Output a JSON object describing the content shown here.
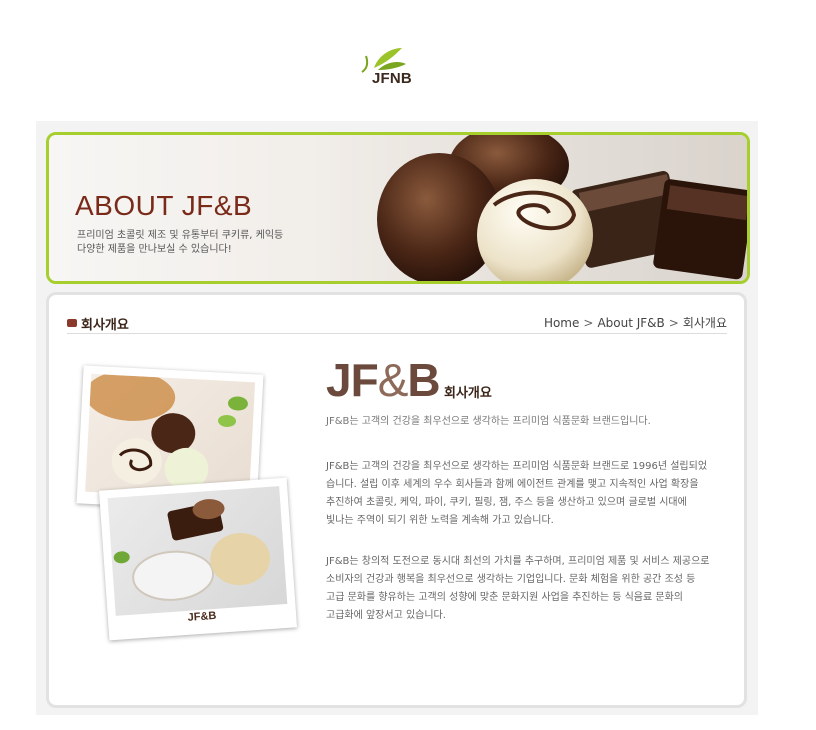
{
  "logo": {
    "text": "JFNB"
  },
  "banner": {
    "title": "ABOUT JF&B",
    "sub_line1": "프리미엄 초콜릿 제조 및 유통부터 쿠키류, 케익등",
    "sub_line2": "다양한 제품을 만나보실 수 있습니다!"
  },
  "section": {
    "heading": "회사개요",
    "breadcrumb": [
      "Home",
      "About JF&B",
      "회사개요"
    ],
    "breadcrumb_sep": ">"
  },
  "photo": {
    "caption": "JF&B"
  },
  "intro": {
    "brand_left": "JF",
    "brand_amp": "&",
    "brand_right": "B",
    "brand_sub": "회사개요",
    "tagline": "JF&B는 고객의 건강을 최우선으로 생각하는 프리미엄 식품문화 브랜드입니다.",
    "paragraph1": [
      "JF&B는 고객의 건강을 최우선으로 생각하는 프리미엄 식품문화 브랜드로 1996년 설립되었",
      "습니다. 설립 이후 세계의 우수 회사들과 함께 에이전트 관계를 맺고 지속적인 사업 확장을",
      "추진하여 초콜릿, 케익, 파이, 쿠키, 필링, 잼, 주스 등을 생산하고 있으며 글로벌 시대에",
      "빛나는 주역이 되기 위한 노력을 계속해 가고 있습니다."
    ],
    "paragraph2": [
      "JF&B는 창의적 도전으로 동시대 최선의 가치를 추구하며, 프리미엄 제품 및 서비스 제공으로",
      "소비자의 건강과 행복을 최우선으로 생각하는 기업입니다. 문화 체험을 위한 공간 조성 등",
      "고급 문화를 향유하는 고객의 성향에 맞춘 문화지원 사업을 추진하는 등 식음료 문화의",
      "고급화에 앞장서고 있습니다."
    ]
  },
  "colors": {
    "accent_green": "#a6cf2e",
    "title_brown": "#7a2a18",
    "brand_brown": "#6b4a3d"
  }
}
